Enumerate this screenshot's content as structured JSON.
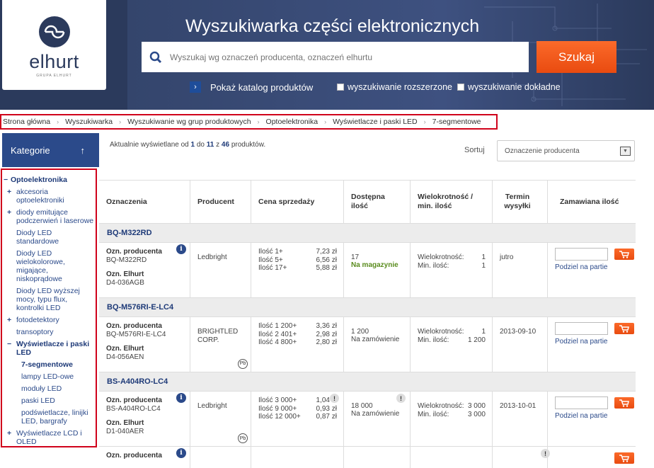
{
  "header": {
    "site_title": "Wyszukiwarka części elektronicznych",
    "logo_name": "elhurt",
    "logo_sub": "GRUPA ELHURT",
    "search_placeholder": "Wyszukaj wg oznaczeń producenta, oznaczeń elhurtu",
    "search_button": "Szukaj",
    "catalog_link": "Pokaż katalog produktów",
    "check_extended": "wyszukiwanie rozszerzone",
    "check_exact": "wyszukiwanie dokładne"
  },
  "breadcrumbs": [
    "Strona główna",
    "Wyszukiwarka",
    "Wyszukiwanie wg grup produktowych",
    "Optoelektronika",
    "Wyświetlacze i paski LED",
    "7-segmentowe"
  ],
  "sidebar": {
    "title": "Kategorie",
    "root": "Optoelektronika",
    "items": [
      {
        "label": "akcesoria optoelektroniki",
        "marker": "+"
      },
      {
        "label": "diody emitujące podczerwień i laserowe",
        "marker": "+"
      },
      {
        "label": "Diody LED standardowe",
        "marker": ""
      },
      {
        "label": "Diody LED wielokolorowe, migające, niskoprądowe",
        "marker": ""
      },
      {
        "label": "Diody LED wyższej mocy, typu flux, kontrolki LED",
        "marker": ""
      },
      {
        "label": "fotodetektory",
        "marker": "+"
      },
      {
        "label": "transoptory",
        "marker": ""
      },
      {
        "label": "Wyświetlacze i paski LED",
        "marker": "−"
      }
    ],
    "subitems": [
      "7-segmentowe",
      "lampy LED-owe",
      "moduły LED",
      "paski LED",
      "podświetlacze, linijki LED, bargrafy"
    ],
    "last_item": {
      "label": "Wyświetlacze LCD i OLED",
      "marker": "+"
    }
  },
  "listing": {
    "info_prefix": "Aktualnie wyświetlane od",
    "from": "1",
    "to_word": "do",
    "to": "11",
    "of_word": "z",
    "total": "46",
    "suffix": "produktów.",
    "sort_label": "Sortuj",
    "sort_value": "Oznaczenie producenta"
  },
  "table": {
    "headers": [
      "Oznaczenia",
      "Producent",
      "Cena sprzedaży",
      "Dostępna ilość",
      "Wielokrotność / min. ilość",
      "Termin wysyłki",
      "Zamawiana ilość"
    ],
    "label_producer_code": "Ozn. producenta",
    "label_elhurt_code": "Ozn. Elhurt",
    "label_multiple": "Wielokrotność:",
    "label_min": "Min. ilość:",
    "partial_text": "Podziel na partie",
    "products": [
      {
        "group": "BQ-M322RD",
        "producer_code": "BQ-M322RD",
        "elhurt_code": "D4-036AGB",
        "producer": "Ledbright",
        "prices": [
          [
            "Ilość 1+",
            "7,23 zł"
          ],
          [
            "Ilość 5+",
            "6,56 zł"
          ],
          [
            "Ilość 17+",
            "5,88 zł"
          ]
        ],
        "qty": "17",
        "avail": "Na magazynie",
        "multiple": "1",
        "min": "1",
        "ship": "jutro"
      },
      {
        "group": "BQ-M576RI-E-LC4",
        "producer_code": "BQ-M576RI-E-LC4",
        "elhurt_code": "D4-056AEN",
        "producer": "BRIGHTLED CORP.",
        "prices": [
          [
            "Ilość 1 200+",
            "3,36 zł"
          ],
          [
            "Ilość 2 401+",
            "2,98 zł"
          ],
          [
            "Ilość 4 800+",
            "2,80 zł"
          ]
        ],
        "qty": "1 200",
        "avail": "Na zamówienie",
        "multiple": "1",
        "min": "1 200",
        "ship": "2013-09-10"
      },
      {
        "group": "BS-A404RO-LC4",
        "producer_code": "BS-A404RO-LC4",
        "elhurt_code": "D1-040AER",
        "producer": "Ledbright",
        "prices": [
          [
            "Ilość 3 000+",
            "1,04 zł"
          ],
          [
            "Ilość 9 000+",
            "0,93 zł"
          ],
          [
            "Ilość 12 000+",
            "0,87 zł"
          ]
        ],
        "qty": "18 000",
        "avail": "Na zamówienie",
        "multiple": "3 000",
        "min": "3 000",
        "ship": "2013-10-01"
      }
    ]
  }
}
